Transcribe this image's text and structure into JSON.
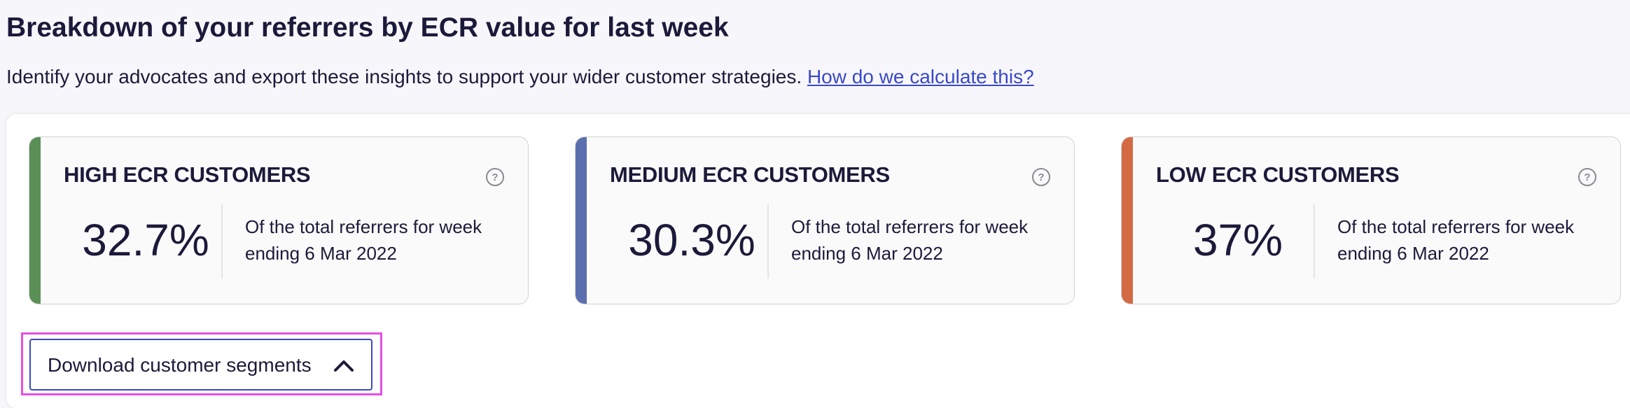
{
  "page": {
    "title": "Breakdown of your referrers by ECR value for last week",
    "subtitle": "Identify your advocates and export these insights to support your wider customer strategies.",
    "help_link": "How do we calculate this?"
  },
  "cards": [
    {
      "title": "HIGH ECR CUSTOMERS",
      "value": "32.7%",
      "desc_line1": "Of the total referrers for week",
      "desc_line2": "ending 6 Mar 2022",
      "accent": "#5a8f55"
    },
    {
      "title": "MEDIUM ECR CUSTOMERS",
      "value": "30.3%",
      "desc_line1": "Of the total referrers for week",
      "desc_line2": "ending 6 Mar 2022",
      "accent": "#5b6fae"
    },
    {
      "title": "LOW ECR CUSTOMERS",
      "value": "37%",
      "desc_line1": "Of the total referrers for week",
      "desc_line2": "ending 6 Mar 2022",
      "accent": "#d46a43"
    }
  ],
  "help_icon": "question-circle-icon",
  "help_icon_glyph": "?",
  "download": {
    "label": "Download customer segments",
    "icon": "chevron-up-icon",
    "highlight": "#e64ee6"
  }
}
